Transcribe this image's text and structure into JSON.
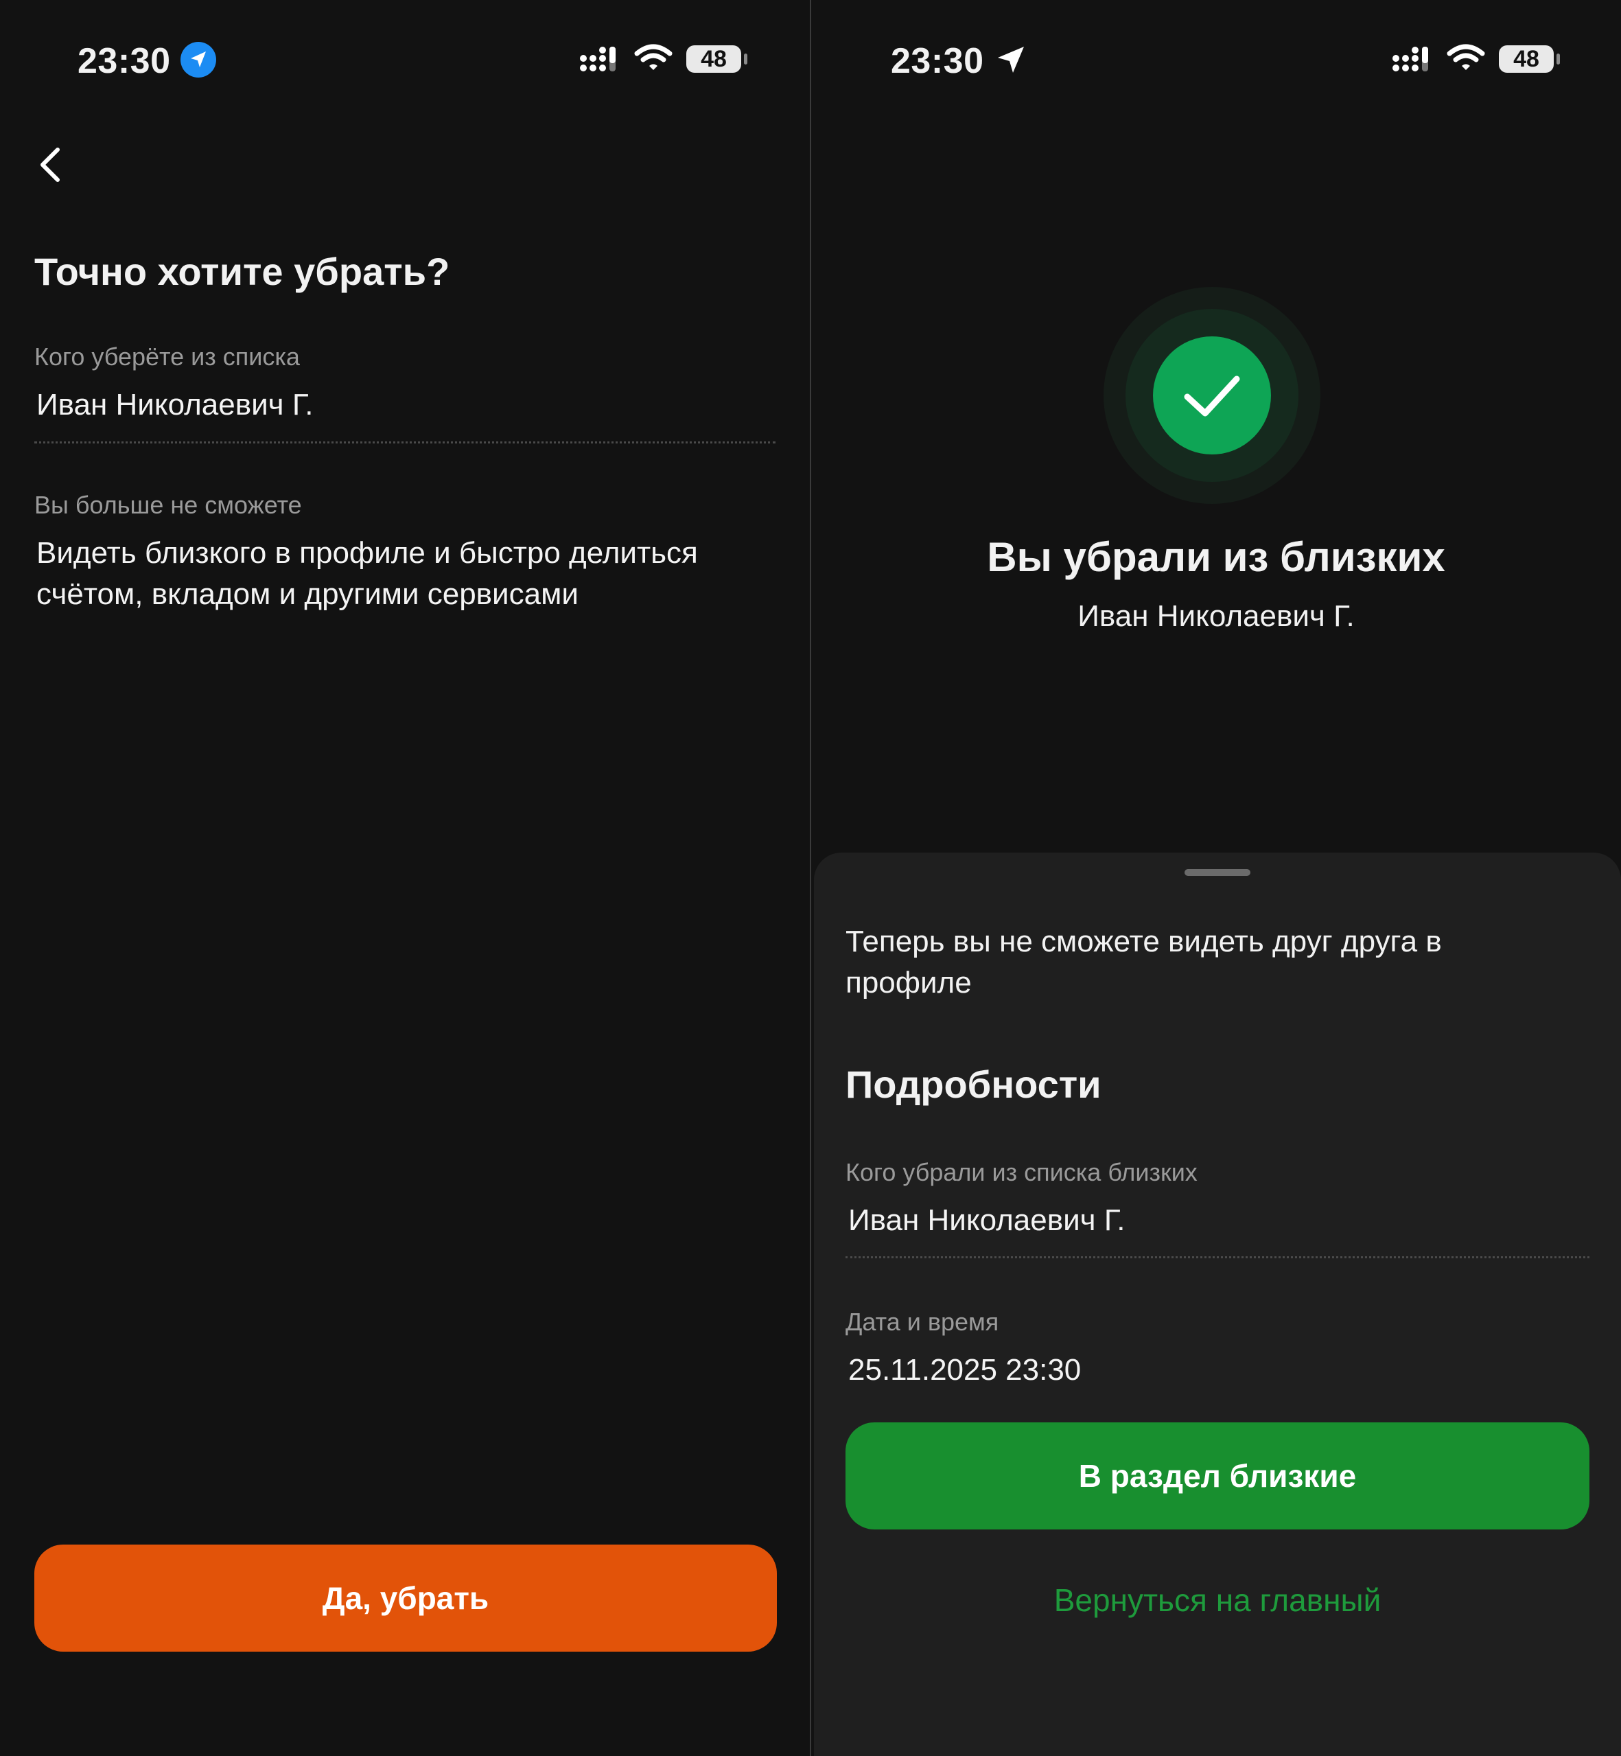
{
  "colors": {
    "background": "#121212",
    "sheet": "#1f1f1f",
    "accent_orange": "#e25309",
    "accent_green": "#188f2f",
    "link_green": "#1e9b3c",
    "success_green": "#0ea555"
  },
  "status_bar": {
    "time": "23:30",
    "battery": "48",
    "icons": [
      "location-arrow-icon",
      "cellular-signal-icon",
      "wifi-icon",
      "battery-icon"
    ]
  },
  "confirm_screen": {
    "back_icon": "chevron-left-icon",
    "title": "Точно хотите убрать?",
    "who_label": "Кого уберёте из списка",
    "who_value": "Иван Николаевич Г.",
    "consequence_label": "Вы больше не сможете",
    "consequence_value": "Видеть близкого в профиле и быстро делиться счётом, вкладом и другими сервисами",
    "confirm_button": "Да, убрать"
  },
  "success_screen": {
    "success_icon": "checkmark-icon",
    "title": "Вы убрали из близких",
    "name": "Иван Николаевич Г.",
    "sheet": {
      "info_text": "Теперь вы не сможете видеть друг друга в профиле",
      "details_heading": "Подробности",
      "removed_label": "Кого убрали из списка близких",
      "removed_value": "Иван Николаевич Г.",
      "datetime_label": "Дата и время",
      "datetime_value": "25.11.2025 23:30",
      "primary_button": "В раздел близкие",
      "secondary_link": "Вернуться на главный"
    }
  }
}
